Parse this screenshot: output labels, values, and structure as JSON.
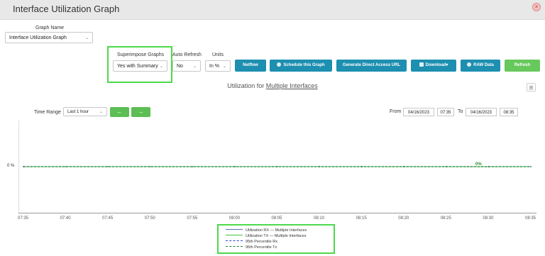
{
  "window": {
    "title": "Interface Utilization Graph",
    "close_icon": "close-icon"
  },
  "graph_name": {
    "label": "Graph Name",
    "value": "Interface Utilization Graph"
  },
  "superimpose": {
    "label": "Superimpose Graphs",
    "value": "Yes with Summary"
  },
  "auto_refresh": {
    "label": "Auto Refresh",
    "value": "No"
  },
  "units": {
    "label": "Units",
    "value": "In %"
  },
  "toolbar": {
    "netflow": "Netflow",
    "schedule": "Schedule this Graph",
    "direct_url": "Generate Direct Access URL",
    "download": "Download",
    "raw_data": "RAW Data",
    "refresh": "Refresh"
  },
  "chart": {
    "title_prefix": "Utilization for ",
    "title_link": "Multiple Interfaces",
    "y_tick": "0 %",
    "annotation": "0%"
  },
  "time_range": {
    "label": "Time Range",
    "value": "Last 1 hour"
  },
  "from_to": {
    "from_label": "From",
    "from_date": "04/16/2023",
    "from_time": "07:35",
    "to_label": "To",
    "to_date": "04/16/2023",
    "to_time": "08:35"
  },
  "chart_data": {
    "type": "line",
    "x": [
      "07:35",
      "07:40",
      "07:45",
      "07:50",
      "07:55",
      "08:00",
      "08:05",
      "08:10",
      "08:15",
      "08:20",
      "08:25",
      "08:30",
      "08:35"
    ],
    "series": [
      {
        "name": "Utilization RX — Multiple Interfaces",
        "values": [
          0,
          0,
          0,
          0,
          0,
          0,
          0,
          0,
          0,
          0,
          0,
          0,
          0
        ],
        "color": "#5b6fb5"
      },
      {
        "name": "Utilization TX — Multiple Interfaces",
        "values": [
          0,
          0,
          0,
          0,
          0,
          0,
          0,
          0,
          0,
          0,
          0,
          0,
          0
        ],
        "color": "#3fc43f"
      },
      {
        "name": "95th Percentile Rx",
        "values": [
          0,
          0,
          0,
          0,
          0,
          0,
          0,
          0,
          0,
          0,
          0,
          0,
          0
        ],
        "color": "#2d3fd6"
      },
      {
        "name": "95th Percentile Tx",
        "values": [
          0,
          0,
          0,
          0,
          0,
          0,
          0,
          0,
          0,
          0,
          0,
          0,
          0
        ],
        "color": "#1e7a3a"
      }
    ],
    "ytick": "0 %",
    "legend": "bottom"
  }
}
